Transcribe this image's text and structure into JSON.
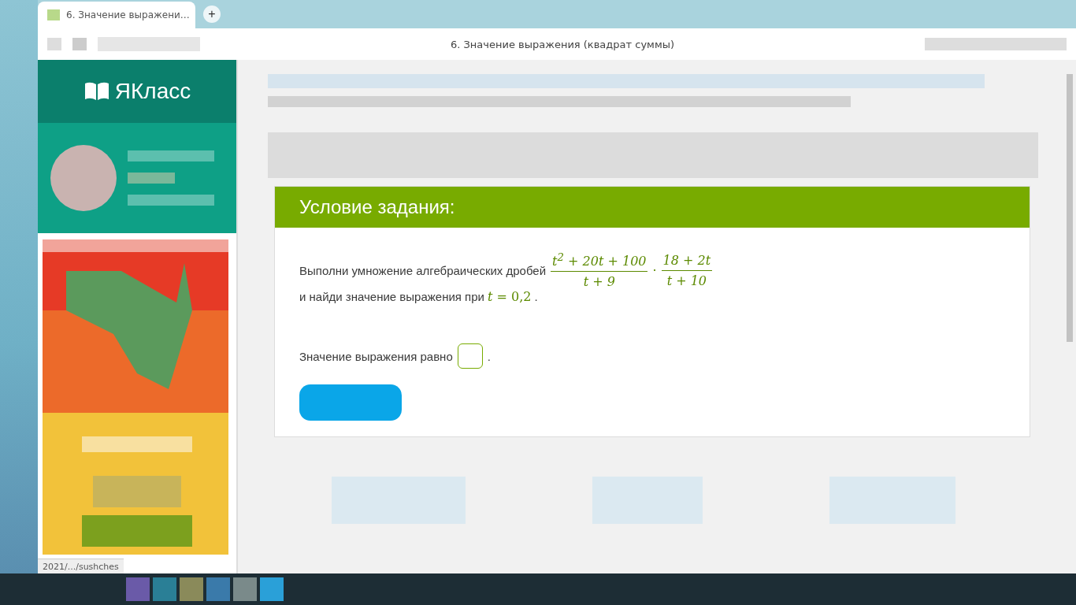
{
  "browser": {
    "tab": {
      "title": "6. Значение выражени…",
      "selected": true
    },
    "new_tab_button": "+",
    "page_title": "6. Значение выражения (квадрат суммы)",
    "status_url": "2021/.../sushches"
  },
  "sidebar": {
    "logo": "ЯКласс"
  },
  "task": {
    "heading": "Условие задания:",
    "text_before": "Выполни умножение алгебраических дробей",
    "fractions": [
      {
        "numerator": "t$^{2}$ + 20t + 100",
        "denominator": "t + 9"
      },
      {
        "numerator": "18 + 2t",
        "denominator": "t + 10"
      }
    ],
    "operator": "·",
    "text_after": "и найди значение выражения при",
    "math_value": "*t* = 0,2",
    "period": ".",
    "answer_label": "Значение выражения равно",
    "answer_period": "."
  }
}
